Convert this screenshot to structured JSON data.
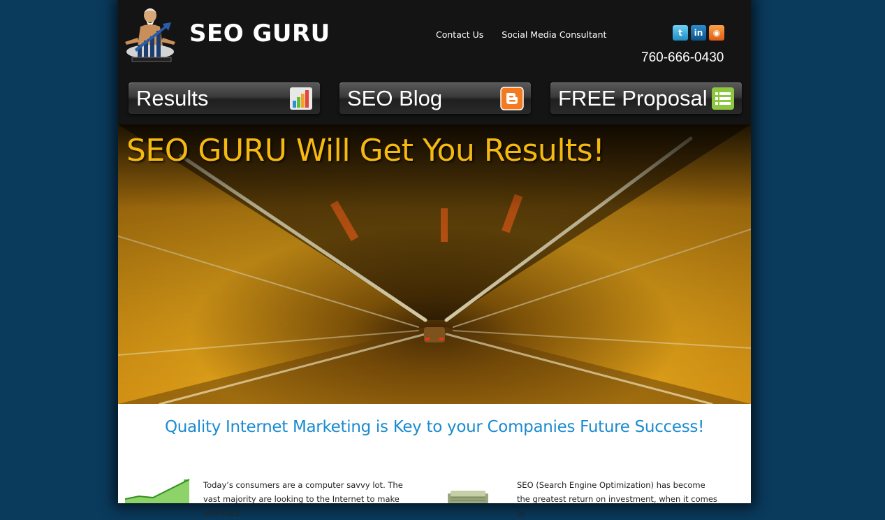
{
  "brand": {
    "name": "SEO GURU"
  },
  "top_links": [
    "Contact Us",
    "Social Media Consultant"
  ],
  "social": [
    {
      "icon": "twitter-icon",
      "glyph": "t",
      "color": "#2fa8de"
    },
    {
      "icon": "linkedin-icon",
      "glyph": "in",
      "color": "#0b5288"
    },
    {
      "icon": "rss-icon",
      "glyph": "◉",
      "color": "#e8701f"
    }
  ],
  "phone": "760-666-0430",
  "nav": [
    {
      "label": "Results",
      "icon": "bar-chart-icon"
    },
    {
      "label": "SEO Blog",
      "icon": "blogger-icon",
      "color": "#f47a20"
    },
    {
      "label": "FREE Proposal",
      "icon": "list-icon",
      "color": "#8dc63f"
    }
  ],
  "hero": {
    "title": "SEO GURU Will Get You Results!"
  },
  "tagline": "Quality Internet Marketing is Key to your Companies Future Success!",
  "columns": [
    {
      "text": "Today’s consumers are a computer savvy lot. The vast majority are looking to the Internet to make informed"
    },
    {
      "text": "SEO (Search Engine Optimization) has become the greatest return on investment, when it comes to"
    }
  ],
  "colors": {
    "background": "#0a3a5c",
    "header": "#141414",
    "accent_title": "#f6b90f",
    "tagline": "#1a8bd0"
  }
}
